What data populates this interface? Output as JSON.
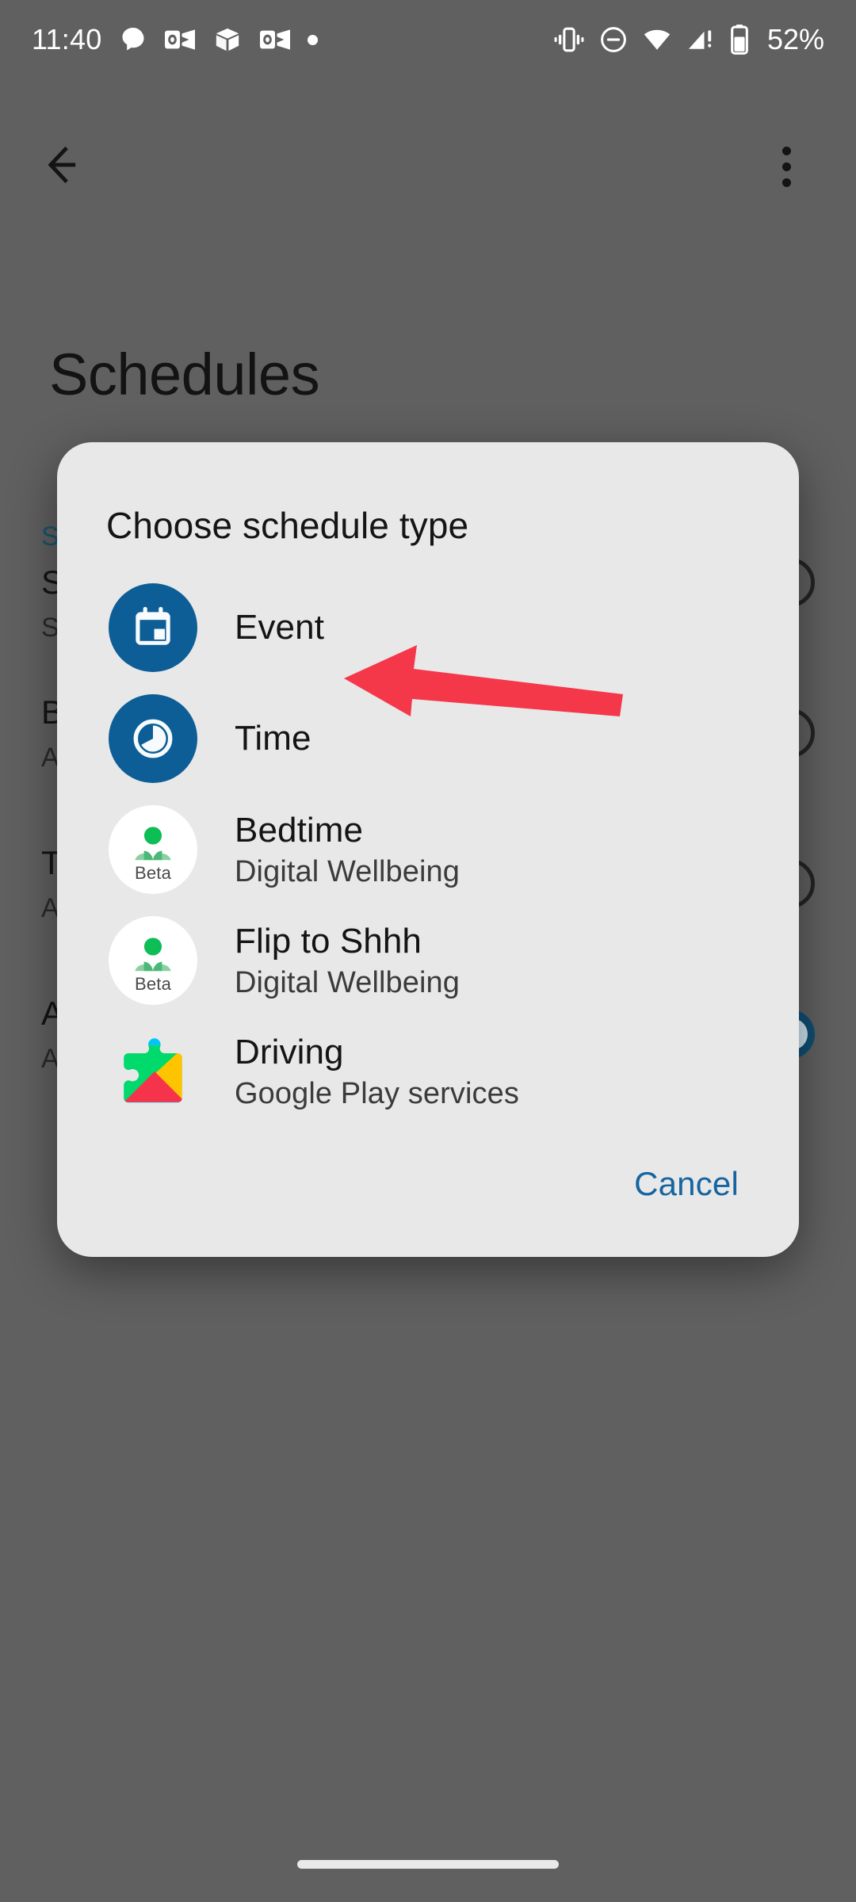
{
  "status_bar": {
    "clock": "11:40",
    "left_icons": [
      "chat-bubble-icon",
      "outlook-icon",
      "3d-box-icon",
      "outlook-icon",
      "dot-icon"
    ],
    "right_icons": [
      "vibrate-icon",
      "do-not-disturb-icon",
      "wifi-icon",
      "cellular-warning-icon",
      "battery-icon"
    ],
    "battery_percent": "52%"
  },
  "app_bar": {
    "back_icon": "arrow-back-icon",
    "overflow_icon": "more-vert-icon"
  },
  "page": {
    "title": "Schedules"
  },
  "background_rows": [
    {
      "title": "S",
      "subtitle": "S",
      "accent": "S",
      "toggle": "off"
    },
    {
      "title": "B",
      "subtitle": "A",
      "accent": "",
      "toggle": "off"
    },
    {
      "title": "T",
      "subtitle": "A",
      "accent": "",
      "toggle": "off"
    },
    {
      "title": "A",
      "subtitle": "A",
      "accent": "",
      "toggle": "on"
    }
  ],
  "dialog": {
    "title": "Choose schedule type",
    "options": [
      {
        "label": "Event",
        "subtitle": "",
        "icon": "calendar-event-icon"
      },
      {
        "label": "Time",
        "subtitle": "",
        "icon": "clock-time-icon"
      },
      {
        "label": "Bedtime",
        "subtitle": "Digital Wellbeing",
        "icon": "digital-wellbeing-beta-icon"
      },
      {
        "label": "Flip to Shhh",
        "subtitle": "Digital Wellbeing",
        "icon": "digital-wellbeing-beta-icon"
      },
      {
        "label": "Driving",
        "subtitle": "Google Play services",
        "icon": "google-play-services-icon"
      }
    ],
    "cancel_label": "Cancel",
    "beta_badge": "Beta"
  },
  "annotation": {
    "arrow_color": "#f4384a",
    "points_to": "Event"
  },
  "colors": {
    "dialog_bg": "#e8e8e8",
    "scrim": "#606060",
    "accent_blue": "#0d5e96",
    "cancel_blue": "#1565a0",
    "wellbeing_green": "#0dbd55",
    "toggle_on": "#0f4f73"
  }
}
